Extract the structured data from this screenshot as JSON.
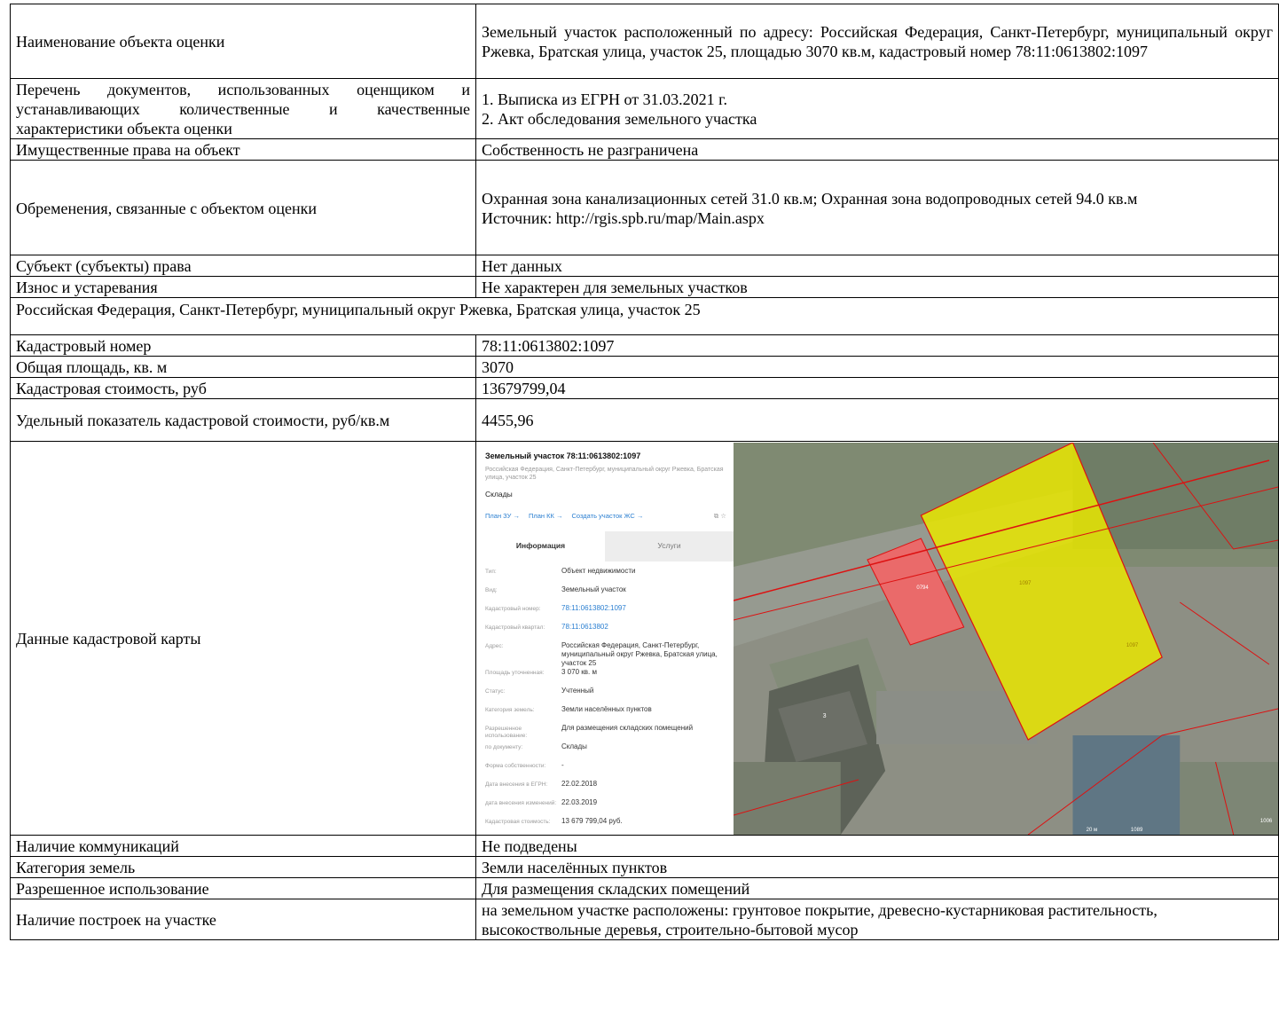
{
  "rows": [
    {
      "label": "Наименование объекта оценки",
      "value": "Земельный участок расположенный по адресу: Российская Федерация, Санкт-Петербург, муниципальный округ Ржевка, Братская улица, участок 25, площадью 3070 кв.м, кадастровый номер 78:11:0613802:1097"
    },
    {
      "label": "Перечень документов, использованных оценщиком и устанавливающих количественные и качественные характеристики объекта оценки",
      "value_lines": [
        "1. Выписка из ЕГРН от 31.03.2021 г.",
        "2. Акт обследования земельного участка"
      ]
    },
    {
      "label": "Имущественные права на объект",
      "value": "Собственность не разграничена"
    },
    {
      "label": "Обременения, связанные с объектом оценки",
      "value_lines": [
        "Охранная зона канализационных сетей 31.0 кв.м; Охранная зона водопроводных сетей 94.0 кв.м",
        "Источник: http://rgis.spb.ru/map/Main.aspx"
      ]
    },
    {
      "label": "Субъект (субъекты) права",
      "value": "Нет данных"
    },
    {
      "label": "Износ и устаревания",
      "value": "Не характерен для земельных участков"
    }
  ],
  "address_row": "Российская Федерация, Санкт-Петербург, муниципальный округ Ржевка, Братская улица, участок 25",
  "rows2": [
    {
      "label": "Кадастровый номер",
      "value": "78:11:0613802:1097"
    },
    {
      "label": "Общая площадь, кв. м",
      "value": "3070"
    },
    {
      "label": "Кадастровая стоимость, руб",
      "value": "13679799,04"
    },
    {
      "label": "Удельный показатель кадастровой стоимости, руб/кв.м",
      "value": "4455,96"
    }
  ],
  "map_row_label": "Данные кадастровой карты",
  "map_panel": {
    "title": "Земельный участок 78:11:0613802:1097",
    "subtitle": "Российская Федерация, Санкт-Петербург, муниципальный округ Ржевка, Братская улица, участок 25",
    "kind": "Склады",
    "links": [
      "План ЗУ →",
      "План КК →",
      "Создать участок ЖС →"
    ],
    "tab_info": "Информация",
    "tab_services": "Услуги",
    "fields": [
      {
        "k": "Тип:",
        "v": "Объект недвижимости"
      },
      {
        "k": "Вид:",
        "v": "Земельный участок"
      },
      {
        "k": "Кадастровый номер:",
        "v": "78:11:0613802:1097",
        "link": true
      },
      {
        "k": "Кадастровый квартал:",
        "v": "78:11:0613802",
        "link": true
      },
      {
        "k": "Адрес:",
        "v": "Российская Федерация, Санкт-Петербург, муниципальный округ Ржевка, Братская улица, участок 25"
      },
      {
        "k": "Площадь уточненная:",
        "v": "3 070 кв. м"
      },
      {
        "k": "Статус:",
        "v": "Учтенный"
      },
      {
        "k": "Категория земель:",
        "v": "Земли населённых пунктов"
      },
      {
        "k": "Разрешенное использование:",
        "v": "Для размещения складских помещений"
      },
      {
        "k": "по документу:",
        "v": "Склады"
      },
      {
        "k": "Форма собственности:",
        "v": "-"
      },
      {
        "k": "Дата внесения в ЕГРН:",
        "v": "22.02.2018"
      },
      {
        "k": "дата внесения изменений:",
        "v": "22.03.2019"
      },
      {
        "k": "Кадастровая стоимость:",
        "v": "13 679 799,04 руб."
      }
    ],
    "map_labels": [
      "1097",
      "1097",
      "0794",
      "3",
      "1089",
      "1006",
      "20 м"
    ]
  },
  "rows3": [
    {
      "label": "Наличие коммуникаций",
      "value": "Не подведены"
    },
    {
      "label": "Категория земель",
      "value": "Земли населённых пунктов"
    },
    {
      "label": "Разрешенное использование",
      "value": "Для размещения складских помещений"
    },
    {
      "label": "Наличие построек на участке",
      "value": "на земельном участке расположены: грунтовое покрытие, древесно-кустарниковая растительность, высокоствольные деревья, строительно-бытовой мусор"
    }
  ],
  "colors": {
    "parcel": "#e9e600",
    "neighbor": "#ea6a6a",
    "boundary": "#d11"
  }
}
